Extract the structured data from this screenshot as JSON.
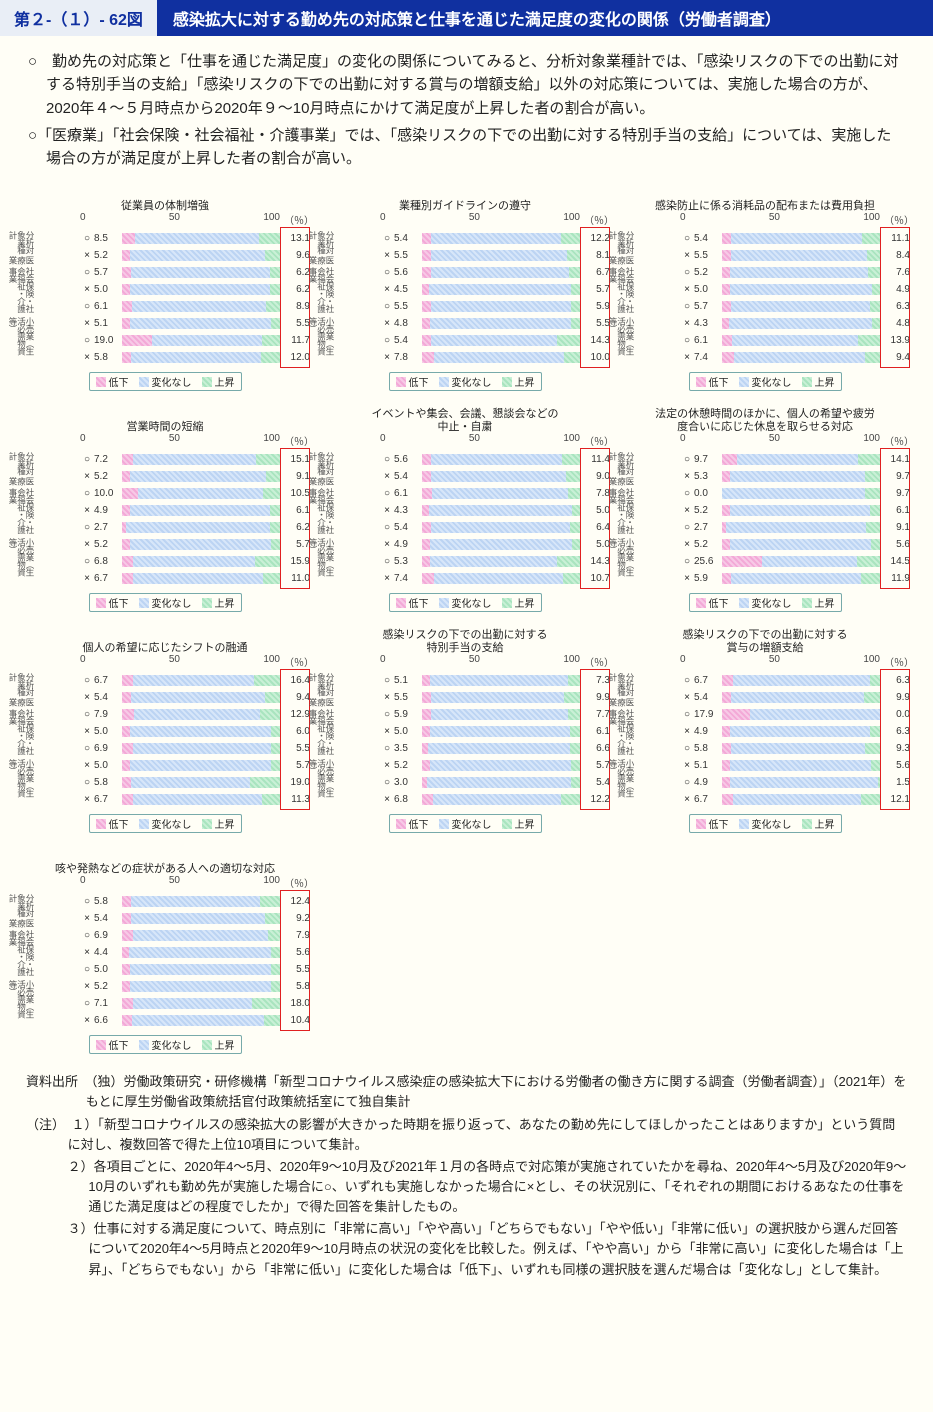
{
  "header": {
    "fig_no": "第２-（１）- 62図",
    "fig_title": "感染拡大に対する勤め先の対応策と仕事を通じた満足度の変化の関係（労働者調査）"
  },
  "lead": [
    "○　勤め先の対応策と「仕事を通じた満足度」の変化の関係についてみると、分析対象業種計では、「感染リスクの下での出勤に対する特別手当の支給」「感染リスクの下での出勤に対する賞与の増額支給」以外の対応策については、実施した場合の方が、2020年４～５月時点から2020年９～10月時点にかけて満足度が上昇した者の割合が高い。",
    "○「医療業」「社会保険・社会福祉・介護事業」では、「感染リスクの下での出勤に対する特別手当の支給」については、実施した場合の方が満足度が上昇した者の割合が高い。"
  ],
  "axis": {
    "ticks": [
      "0",
      "50",
      "100"
    ],
    "unit": "（％）"
  },
  "legend": [
    "低下",
    "変化なし",
    "上昇"
  ],
  "ygroups": [
    "分析対象業種計",
    "医療業",
    "社会保険・社会福祉・介護事業",
    "小売業（生活必需物資等）"
  ],
  "marks": [
    "○",
    "×"
  ],
  "chart_data": [
    {
      "title": "従業員の体制増強",
      "type": "bar",
      "rows": [
        {
          "g": 0,
          "m": 0,
          "low": 8.5,
          "up": 13.1
        },
        {
          "g": 0,
          "m": 1,
          "low": 5.2,
          "up": 9.6
        },
        {
          "g": 1,
          "m": 0,
          "low": 5.7,
          "up": 6.2
        },
        {
          "g": 1,
          "m": 1,
          "low": 5.0,
          "up": 6.2
        },
        {
          "g": 2,
          "m": 0,
          "low": 6.1,
          "up": 8.9
        },
        {
          "g": 2,
          "m": 1,
          "low": 5.1,
          "up": 5.5
        },
        {
          "g": 3,
          "m": 0,
          "low": 19.0,
          "up": 11.7
        },
        {
          "g": 3,
          "m": 1,
          "low": 5.8,
          "up": 12.0
        }
      ]
    },
    {
      "title": "業種別ガイドラインの遵守",
      "type": "bar",
      "rows": [
        {
          "g": 0,
          "m": 0,
          "low": 5.4,
          "up": 12.2
        },
        {
          "g": 0,
          "m": 1,
          "low": 5.5,
          "up": 8.1
        },
        {
          "g": 1,
          "m": 0,
          "low": 5.6,
          "up": 6.7
        },
        {
          "g": 1,
          "m": 1,
          "low": 4.5,
          "up": 5.7
        },
        {
          "g": 2,
          "m": 0,
          "low": 5.5,
          "up": 5.9
        },
        {
          "g": 2,
          "m": 1,
          "low": 4.8,
          "up": 5.5
        },
        {
          "g": 3,
          "m": 0,
          "low": 5.4,
          "up": 14.3
        },
        {
          "g": 3,
          "m": 1,
          "low": 7.8,
          "up": 10.0
        }
      ]
    },
    {
      "title": "感染防止に係る消耗品の配布または費用負担",
      "type": "bar",
      "rows": [
        {
          "g": 0,
          "m": 0,
          "low": 5.4,
          "up": 11.1
        },
        {
          "g": 0,
          "m": 1,
          "low": 5.5,
          "up": 8.4
        },
        {
          "g": 1,
          "m": 0,
          "low": 5.2,
          "up": 7.6
        },
        {
          "g": 1,
          "m": 1,
          "low": 5.0,
          "up": 4.9
        },
        {
          "g": 2,
          "m": 0,
          "low": 5.7,
          "up": 6.3
        },
        {
          "g": 2,
          "m": 1,
          "low": 4.3,
          "up": 4.8
        },
        {
          "g": 3,
          "m": 0,
          "low": 6.1,
          "up": 13.9
        },
        {
          "g": 3,
          "m": 1,
          "low": 7.4,
          "up": 9.4
        }
      ]
    },
    {
      "title": "営業時間の短縮",
      "type": "bar",
      "rows": [
        {
          "g": 0,
          "m": 0,
          "low": 7.2,
          "up": 15.1
        },
        {
          "g": 0,
          "m": 1,
          "low": 5.2,
          "up": 9.1
        },
        {
          "g": 1,
          "m": 0,
          "low": 10.0,
          "up": 10.5
        },
        {
          "g": 1,
          "m": 1,
          "low": 4.9,
          "up": 6.1
        },
        {
          "g": 2,
          "m": 0,
          "low": 2.7,
          "up": 6.2
        },
        {
          "g": 2,
          "m": 1,
          "low": 5.2,
          "up": 5.7
        },
        {
          "g": 3,
          "m": 0,
          "low": 6.8,
          "up": 15.9
        },
        {
          "g": 3,
          "m": 1,
          "low": 6.7,
          "up": 11.0
        }
      ]
    },
    {
      "title": "イベントや集会、会議、懇談会などの\\n中止・自粛",
      "type": "bar",
      "rows": [
        {
          "g": 0,
          "m": 0,
          "low": 5.6,
          "up": 11.4
        },
        {
          "g": 0,
          "m": 1,
          "low": 5.4,
          "up": 9.0
        },
        {
          "g": 1,
          "m": 0,
          "low": 6.1,
          "up": 7.8
        },
        {
          "g": 1,
          "m": 1,
          "low": 4.3,
          "up": 5.0
        },
        {
          "g": 2,
          "m": 0,
          "low": 5.4,
          "up": 6.4
        },
        {
          "g": 2,
          "m": 1,
          "low": 4.9,
          "up": 5.0
        },
        {
          "g": 3,
          "m": 0,
          "low": 5.3,
          "up": 14.3
        },
        {
          "g": 3,
          "m": 1,
          "low": 7.4,
          "up": 10.7
        }
      ]
    },
    {
      "title": "法定の休憩時間のほかに、個人の希望や疲労\\n度合いに応じた休息を取らせる対応",
      "type": "bar",
      "rows": [
        {
          "g": 0,
          "m": 0,
          "low": 9.7,
          "up": 14.1
        },
        {
          "g": 0,
          "m": 1,
          "low": 5.3,
          "up": 9.7
        },
        {
          "g": 1,
          "m": 0,
          "low": 0.0,
          "up": 9.7
        },
        {
          "g": 1,
          "m": 1,
          "low": 5.2,
          "up": 6.1
        },
        {
          "g": 2,
          "m": 0,
          "low": 2.7,
          "up": 9.1
        },
        {
          "g": 2,
          "m": 1,
          "low": 5.2,
          "up": 5.6
        },
        {
          "g": 3,
          "m": 0,
          "low": 25.6,
          "up": 14.5
        },
        {
          "g": 3,
          "m": 1,
          "low": 5.9,
          "up": 11.9
        }
      ]
    },
    {
      "title": "個人の希望に応じたシフトの融通",
      "type": "bar",
      "rows": [
        {
          "g": 0,
          "m": 0,
          "low": 6.7,
          "up": 16.4
        },
        {
          "g": 0,
          "m": 1,
          "low": 5.4,
          "up": 9.4
        },
        {
          "g": 1,
          "m": 0,
          "low": 7.9,
          "up": 12.9
        },
        {
          "g": 1,
          "m": 1,
          "low": 5.0,
          "up": 6.0
        },
        {
          "g": 2,
          "m": 0,
          "low": 6.9,
          "up": 5.5
        },
        {
          "g": 2,
          "m": 1,
          "low": 5.0,
          "up": 5.7
        },
        {
          "g": 3,
          "m": 0,
          "low": 5.8,
          "up": 19.0
        },
        {
          "g": 3,
          "m": 1,
          "low": 6.7,
          "up": 11.3
        }
      ]
    },
    {
      "title": "感染リスクの下での出勤に対する\\n特別手当の支給",
      "type": "bar",
      "rows": [
        {
          "g": 0,
          "m": 0,
          "low": 5.1,
          "up": 7.3
        },
        {
          "g": 0,
          "m": 1,
          "low": 5.5,
          "up": 9.9
        },
        {
          "g": 1,
          "m": 0,
          "low": 5.9,
          "up": 7.7
        },
        {
          "g": 1,
          "m": 1,
          "low": 5.0,
          "up": 6.1
        },
        {
          "g": 2,
          "m": 0,
          "low": 3.5,
          "up": 6.6
        },
        {
          "g": 2,
          "m": 1,
          "low": 5.2,
          "up": 5.7
        },
        {
          "g": 3,
          "m": 0,
          "low": 3.0,
          "up": 5.4
        },
        {
          "g": 3,
          "m": 1,
          "low": 6.8,
          "up": 12.2
        }
      ]
    },
    {
      "title": "感染リスクの下での出勤に対する\\n賞与の増額支給",
      "type": "bar",
      "rows": [
        {
          "g": 0,
          "m": 0,
          "low": 6.7,
          "up": 6.3
        },
        {
          "g": 0,
          "m": 1,
          "low": 5.4,
          "up": 9.9
        },
        {
          "g": 1,
          "m": 0,
          "low": 17.9,
          "up": 0.0
        },
        {
          "g": 1,
          "m": 1,
          "low": 4.9,
          "up": 6.3
        },
        {
          "g": 2,
          "m": 0,
          "low": 5.8,
          "up": 9.3
        },
        {
          "g": 2,
          "m": 1,
          "low": 5.1,
          "up": 5.6
        },
        {
          "g": 3,
          "m": 0,
          "low": 4.9,
          "up": 1.5
        },
        {
          "g": 3,
          "m": 1,
          "low": 6.7,
          "up": 12.1
        }
      ]
    },
    {
      "title": "咳や発熱などの症状がある人への適切な対応",
      "type": "bar",
      "rows": [
        {
          "g": 0,
          "m": 0,
          "low": 5.8,
          "up": 12.4
        },
        {
          "g": 0,
          "m": 1,
          "low": 5.4,
          "up": 9.2
        },
        {
          "g": 1,
          "m": 0,
          "low": 6.9,
          "up": 7.9
        },
        {
          "g": 1,
          "m": 1,
          "low": 4.4,
          "up": 5.6
        },
        {
          "g": 2,
          "m": 0,
          "low": 5.0,
          "up": 5.5
        },
        {
          "g": 2,
          "m": 1,
          "low": 5.2,
          "up": 5.8
        },
        {
          "g": 3,
          "m": 0,
          "low": 7.1,
          "up": 18.0
        },
        {
          "g": 3,
          "m": 1,
          "low": 6.6,
          "up": 10.4
        }
      ]
    }
  ],
  "source": [
    "資料出所　（独）労働政策研究・研修機構「新型コロナウイルス感染症の感染拡大下における労働者の働き方に関する調査（労働者調査）」（2021年）をもとに厚生労働省政策統括官付政策統括室にて独自集計",
    "（注）　１）「新型コロナウイルスの感染拡大の影響が大きかった時期を振り返って、あなたの勤め先にしてほしかったことはありますか」という質問に対し、複数回答で得た上位10項目について集計。",
    "２）各項目ごとに、2020年4～5月、2020年9～10月及び2021年１月の各時点で対応策が実施されていたかを尋ね、2020年4～5月及び2020年9～10月のいずれも勤め先が実施した場合に○、いずれも実施しなかった場合に×とし、その状況別に、「それぞれの期間におけるあなたの仕事を通じた満足度はどの程度でしたか」で得た回答を集計したもの。",
    "３）仕事に対する満足度について、時点別に「非常に高い」「やや高い」「どちらでもない」「やや低い」「非常に低い」の選択肢から選んだ回答について2020年4～5月時点と2020年9～10月時点の状況の変化を比較した。例えば、「やや高い」から「非常に高い」に変化した場合は「上昇」、「どちらでもない」から「非常に低い」に変化した場合は「低下」、いずれも同様の選択肢を選んだ場合は「変化なし」として集計。"
  ]
}
